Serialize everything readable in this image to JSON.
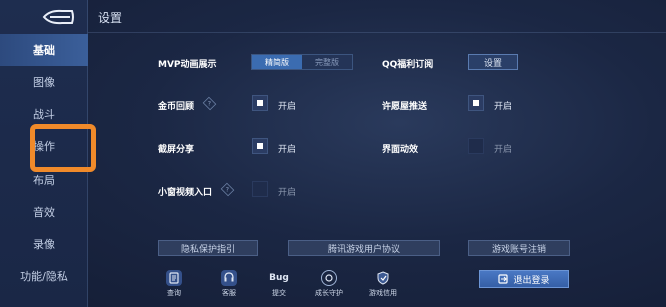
{
  "header": {
    "title": "设置"
  },
  "sidebar": {
    "items": [
      {
        "label": "基础"
      },
      {
        "label": "图像"
      },
      {
        "label": "战斗"
      },
      {
        "label": "操作"
      },
      {
        "label": "布局"
      },
      {
        "label": "音效"
      },
      {
        "label": "录像"
      },
      {
        "label": "功能/隐私"
      }
    ],
    "active_index": 0,
    "highlighted_index": 3,
    "highlight_color": "#f08a2a"
  },
  "settings": {
    "mvp": {
      "label": "MVP动画展示",
      "options": [
        "精简版",
        "完整版"
      ],
      "selected": "精简版"
    },
    "qq_sub": {
      "label": "QQ福利订阅",
      "button": "设置"
    },
    "coin_review": {
      "label": "金币回顾",
      "help_icon": "?",
      "checked": true,
      "value": "开启"
    },
    "wish_push": {
      "label": "许愿屋推送",
      "checked": true,
      "value": "开启"
    },
    "screenshot_share": {
      "label": "截屏分享",
      "checked": true,
      "value": "开启"
    },
    "ui_anim": {
      "label": "界面动效",
      "checked": false,
      "value": "开启"
    },
    "mini_video": {
      "label": "小窗视频入口",
      "help_icon": "?",
      "checked": false,
      "value": "开启"
    }
  },
  "links": {
    "privacy": "隐私保护指引",
    "agreement": "腾讯游戏用户协议",
    "cancel_account": "游戏账号注销"
  },
  "bottom": {
    "items": [
      {
        "label": "查询",
        "icon": "query-icon"
      },
      {
        "label": "客服",
        "icon": "service-icon"
      },
      {
        "label": "提交",
        "icon_text": "Bug"
      },
      {
        "label": "成长守护",
        "icon": "growth-guard-icon"
      },
      {
        "label": "游戏信用",
        "icon": "credit-icon"
      }
    ],
    "logout": "退出登录"
  }
}
